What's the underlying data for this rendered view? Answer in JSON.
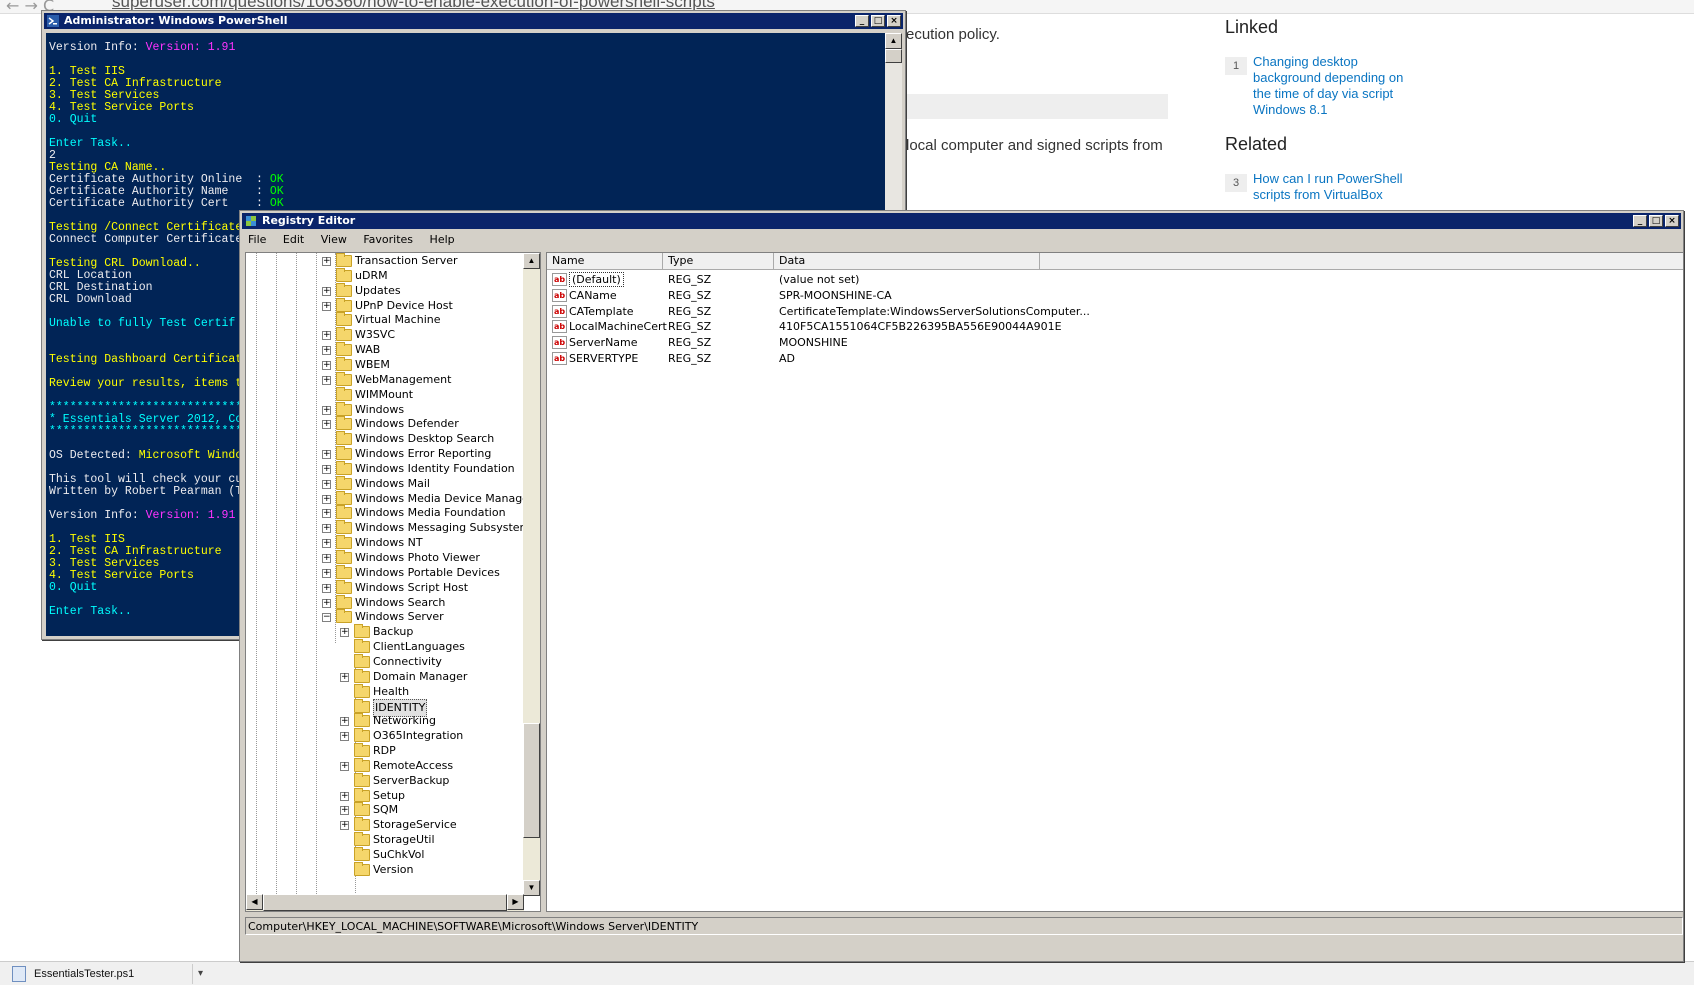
{
  "browser": {
    "nav_icons": "←  →  C",
    "url": "superuser.com/questions/106360/how-to-enable-execution-of-powershell-scripts",
    "text_1": "ecution policy.",
    "text_2": "local computer and signed scripts from",
    "linked_heading": "Linked",
    "related_heading": "Related",
    "linked_items": [
      {
        "count": "1",
        "text": "Changing desktop background depending on the time of day via script Windows 8.1"
      }
    ],
    "related_items": [
      {
        "count": "3",
        "text": "How can I run PowerShell scripts from VirtualBox"
      }
    ]
  },
  "download_bar": {
    "file_name": "EssentialsTester.ps1",
    "chevron": "▾"
  },
  "powershell": {
    "title": "Administrator: Windows PowerShell",
    "controls": {
      "minimize": "_",
      "maximize": "□",
      "close": "×"
    },
    "lines": [
      [
        {
          "t": "Version Info: ",
          "c": "c-w"
        },
        {
          "t": "Version: 1.91",
          "c": "c-m"
        }
      ],
      [],
      [
        {
          "t": "1. Test IIS",
          "c": "c-y"
        }
      ],
      [
        {
          "t": "2. Test CA Infrastructure",
          "c": "c-y"
        }
      ],
      [
        {
          "t": "3. Test Services",
          "c": "c-y"
        }
      ],
      [
        {
          "t": "4. Test Service Ports",
          "c": "c-y"
        }
      ],
      [
        {
          "t": "0. Quit",
          "c": "c-c"
        }
      ],
      [],
      [
        {
          "t": "Enter Task..",
          "c": "c-c"
        }
      ],
      [
        {
          "t": "2",
          "c": "c-w"
        }
      ],
      [
        {
          "t": "Testing CA Name..",
          "c": "c-y"
        }
      ],
      [
        {
          "t": "Certificate Authority Online  : ",
          "c": "c-w"
        },
        {
          "t": "OK",
          "c": "c-g"
        }
      ],
      [
        {
          "t": "Certificate Authority Name    : ",
          "c": "c-w"
        },
        {
          "t": "OK",
          "c": "c-g"
        }
      ],
      [
        {
          "t": "Certificate Authority Cert    : ",
          "c": "c-w"
        },
        {
          "t": "OK",
          "c": "c-g"
        }
      ],
      [],
      [
        {
          "t": "Testing /Connect Certificate",
          "c": "c-y"
        }
      ],
      [
        {
          "t": "Connect Computer Certificate",
          "c": "c-w"
        }
      ],
      [],
      [
        {
          "t": "Testing CRL Download..",
          "c": "c-y"
        }
      ],
      [
        {
          "t": "CRL Location",
          "c": "c-w"
        }
      ],
      [
        {
          "t": "CRL Destination",
          "c": "c-w"
        }
      ],
      [
        {
          "t": "CRL Download",
          "c": "c-w"
        }
      ],
      [],
      [
        {
          "t": "Unable to fully Test Certif",
          "c": "c-c"
        }
      ],
      [],
      [],
      [
        {
          "t": "Testing Dashboard Certificat",
          "c": "c-y"
        }
      ],
      [],
      [
        {
          "t": "Review your results, items t",
          "c": "c-y"
        }
      ],
      [],
      [
        {
          "t": "****************************",
          "c": "c-c"
        }
      ],
      [
        {
          "t": "* Essentials Server 2012, Co",
          "c": "c-c"
        }
      ],
      [
        {
          "t": "****************************",
          "c": "c-c"
        }
      ],
      [],
      [
        {
          "t": "OS Detected: ",
          "c": "c-w"
        },
        {
          "t": "Microsoft Windo",
          "c": "c-y"
        }
      ],
      [],
      [
        {
          "t": "This tool will check your cu",
          "c": "c-w"
        }
      ],
      [
        {
          "t": "Written by Robert Pearman (T",
          "c": "c-w"
        }
      ],
      [],
      [
        {
          "t": "Version Info: ",
          "c": "c-w"
        },
        {
          "t": "Version: 1.91",
          "c": "c-m"
        }
      ],
      [],
      [
        {
          "t": "1. Test IIS",
          "c": "c-y"
        }
      ],
      [
        {
          "t": "2. Test CA Infrastructure",
          "c": "c-y"
        }
      ],
      [
        {
          "t": "3. Test Services",
          "c": "c-y"
        }
      ],
      [
        {
          "t": "4. Test Service Ports",
          "c": "c-y"
        }
      ],
      [
        {
          "t": "0. Quit",
          "c": "c-c"
        }
      ],
      [],
      [
        {
          "t": "Enter Task..",
          "c": "c-c"
        }
      ]
    ]
  },
  "registry": {
    "title": "Registry Editor",
    "controls": {
      "minimize": "_",
      "maximize": "□",
      "close": "×"
    },
    "menu": [
      "File",
      "Edit",
      "View",
      "Favorites",
      "Help"
    ],
    "tree": [
      {
        "label": "Transaction Server",
        "level": 0,
        "exp": "+"
      },
      {
        "label": "uDRM",
        "level": 0,
        "exp": ""
      },
      {
        "label": "Updates",
        "level": 0,
        "exp": "+"
      },
      {
        "label": "UPnP Device Host",
        "level": 0,
        "exp": "+"
      },
      {
        "label": "Virtual Machine",
        "level": 0,
        "exp": ""
      },
      {
        "label": "W3SVC",
        "level": 0,
        "exp": "+"
      },
      {
        "label": "WAB",
        "level": 0,
        "exp": "+"
      },
      {
        "label": "WBEM",
        "level": 0,
        "exp": "+"
      },
      {
        "label": "WebManagement",
        "level": 0,
        "exp": "+"
      },
      {
        "label": "WIMMount",
        "level": 0,
        "exp": ""
      },
      {
        "label": "Windows",
        "level": 0,
        "exp": "+"
      },
      {
        "label": "Windows Defender",
        "level": 0,
        "exp": "+"
      },
      {
        "label": "Windows Desktop Search",
        "level": 0,
        "exp": ""
      },
      {
        "label": "Windows Error Reporting",
        "level": 0,
        "exp": "+"
      },
      {
        "label": "Windows Identity Foundation",
        "level": 0,
        "exp": "+"
      },
      {
        "label": "Windows Mail",
        "level": 0,
        "exp": "+"
      },
      {
        "label": "Windows Media Device Manager",
        "level": 0,
        "exp": "+"
      },
      {
        "label": "Windows Media Foundation",
        "level": 0,
        "exp": "+"
      },
      {
        "label": "Windows Messaging Subsystem",
        "level": 0,
        "exp": "+"
      },
      {
        "label": "Windows NT",
        "level": 0,
        "exp": "+"
      },
      {
        "label": "Windows Photo Viewer",
        "level": 0,
        "exp": "+"
      },
      {
        "label": "Windows Portable Devices",
        "level": 0,
        "exp": "+"
      },
      {
        "label": "Windows Script Host",
        "level": 0,
        "exp": "+"
      },
      {
        "label": "Windows Search",
        "level": 0,
        "exp": "+"
      },
      {
        "label": "Windows Server",
        "level": 0,
        "exp": "−"
      },
      {
        "label": "Backup",
        "level": 1,
        "exp": "+"
      },
      {
        "label": "ClientLanguages",
        "level": 1,
        "exp": ""
      },
      {
        "label": "Connectivity",
        "level": 1,
        "exp": ""
      },
      {
        "label": "Domain Manager",
        "level": 1,
        "exp": "+"
      },
      {
        "label": "Health",
        "level": 1,
        "exp": ""
      },
      {
        "label": "IDENTITY",
        "level": 1,
        "exp": "",
        "selected": true
      },
      {
        "label": "Networking",
        "level": 1,
        "exp": "+"
      },
      {
        "label": "O365Integration",
        "level": 1,
        "exp": "+"
      },
      {
        "label": "RDP",
        "level": 1,
        "exp": ""
      },
      {
        "label": "RemoteAccess",
        "level": 1,
        "exp": "+"
      },
      {
        "label": "ServerBackup",
        "level": 1,
        "exp": ""
      },
      {
        "label": "Setup",
        "level": 1,
        "exp": "+"
      },
      {
        "label": "SQM",
        "level": 1,
        "exp": "+"
      },
      {
        "label": "StorageService",
        "level": 1,
        "exp": "+"
      },
      {
        "label": "StorageUtil",
        "level": 1,
        "exp": ""
      },
      {
        "label": "SuChkVol",
        "level": 1,
        "exp": ""
      },
      {
        "label": "Version",
        "level": 1,
        "exp": ""
      }
    ],
    "columns": [
      "Name",
      "Type",
      "Data"
    ],
    "values": [
      {
        "icon": "ab",
        "name": "(Default)",
        "type": "REG_SZ",
        "data": "(value not set)"
      },
      {
        "icon": "ab",
        "name": "CAName",
        "type": "REG_SZ",
        "data": "SPR-MOONSHINE-CA"
      },
      {
        "icon": "ab",
        "name": "CATemplate",
        "type": "REG_SZ",
        "data": "CertificateTemplate:WindowsServerSolutionsComputer..."
      },
      {
        "icon": "ab",
        "name": "LocalMachineCert",
        "type": "REG_SZ",
        "data": "410F5CA1551064CF5B226395BA556E90044A901E"
      },
      {
        "icon": "ab",
        "name": "ServerName",
        "type": "REG_SZ",
        "data": "MOONSHINE"
      },
      {
        "icon": "ab",
        "name": "SERVERTYPE",
        "type": "REG_SZ",
        "data": "AD"
      }
    ],
    "status": "Computer\\HKEY_LOCAL_MACHINE\\SOFTWARE\\Microsoft\\Windows Server\\IDENTITY",
    "scroll_arrows": {
      "up": "▲",
      "down": "▼",
      "left": "◀",
      "right": "▶"
    }
  }
}
